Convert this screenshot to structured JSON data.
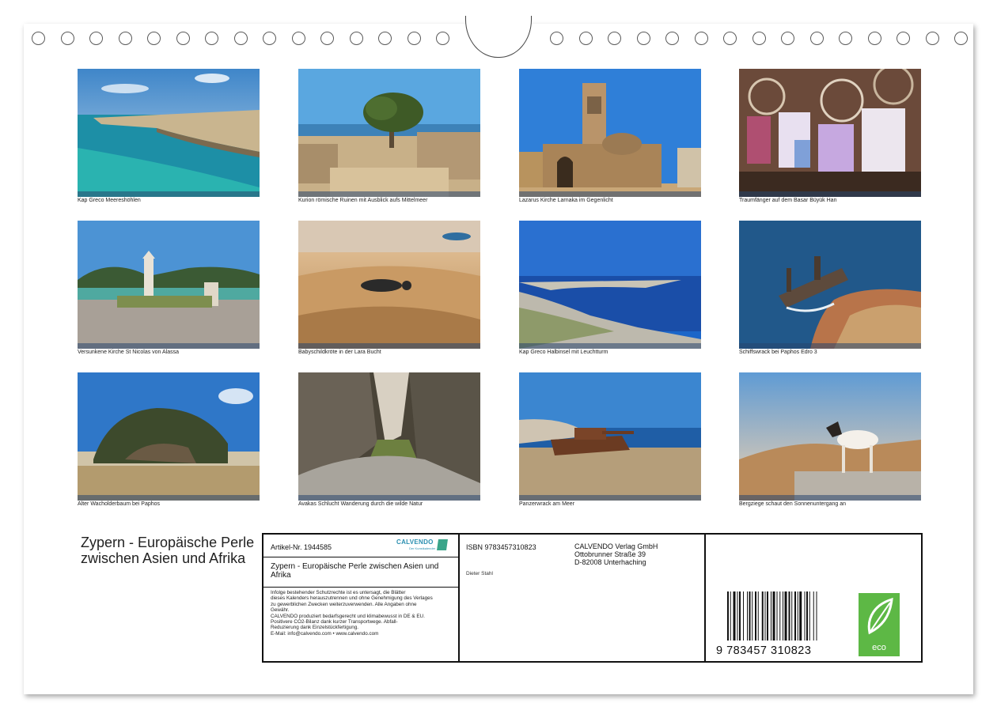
{
  "photos": [
    {
      "caption": "Kap Greco Meereshöhlen",
      "scene": "sea-cliffs"
    },
    {
      "caption": "Kurion römische Ruinen mit Ausblick aufs Mittelmeer",
      "scene": "ruins"
    },
    {
      "caption": "Lazarus Kirche Larnaka im Gegenlicht",
      "scene": "church"
    },
    {
      "caption": "Traumfänger auf dem Basar Büyük Han",
      "scene": "dreamcatchers"
    },
    {
      "caption": "Versunkene Kirche St Nicolas von Alassa",
      "scene": "sunken-church"
    },
    {
      "caption": "Babyschildkröte in der Lara Bucht",
      "scene": "turtle"
    },
    {
      "caption": "Kap Greco Halbinsel mit Leuchtturm",
      "scene": "peninsula"
    },
    {
      "caption": "Schiffswrack bei Paphos Edro 3",
      "scene": "shipwreck"
    },
    {
      "caption": "Alter Wacholderbaum bei Paphos",
      "scene": "juniper"
    },
    {
      "caption": "Avakas Schlucht Wanderung durch die wilde Natur",
      "scene": "gorge"
    },
    {
      "caption": "Panzerwrack am Meer",
      "scene": "tank"
    },
    {
      "caption": "Bergziege schaut den Sonnenuntergang an",
      "scene": "goat"
    }
  ],
  "title": "Zypern - Europäische Perle zwischen Asien und Afrika",
  "imprint": {
    "article": "Artikel-Nr. 1944585",
    "logo": "CALVENDO",
    "logo_sub": "Der Kunstkalender",
    "title": "Zypern - Europäische Perle zwischen Asien und Afrika",
    "legal": [
      "Infolge bestehender Schutzrechte ist es untersagt, die Blätter",
      "dieses Kalenders herauszutrennen und ohne Genehmigung des Verlages",
      "zu gewerblichen Zwecken weiterzuverwenden. Alle Angaben ohne",
      "Gewähr.",
      "CALVENDO produziert bedarfsgerecht und klimabewusst in DE & EU.",
      "Positivere CO2-Bilanz dank kurzer Transportwege. Abfall-",
      "Reduzierung dank Einzelstückfertigung.",
      "E-Mail: info@calvendo.com • www.calvendo.com"
    ],
    "isbn": "ISBN 9783457310823",
    "author": "Dieter Stahl",
    "publisher": [
      "CALVENDO Verlag GmbH",
      "Ottobrunner Straße 39",
      "D-82008 Unterhaching"
    ],
    "barcode_digits": "9  783457  310823",
    "eco_label": "eco"
  }
}
